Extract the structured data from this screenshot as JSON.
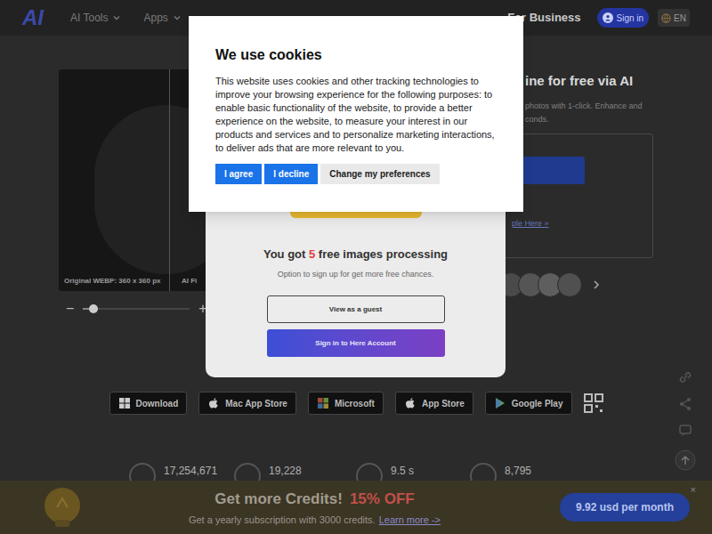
{
  "header": {
    "logo": "AI",
    "nav": [
      {
        "label": "AI Tools"
      },
      {
        "label": "Apps"
      }
    ],
    "business": "For Business",
    "sign_in": "Sign in",
    "language": "EN"
  },
  "hero": {
    "title": "ine for free via AI",
    "subtitle": [
      "photos with 1-click. Enhance and",
      "conds."
    ],
    "sample_link": "ple Here »"
  },
  "preview": {
    "caption_original": "Original WEBP: 360 x 360 px",
    "caption_result": "AI Fi",
    "zoom_out": "−",
    "zoom_in": "+",
    "zoom_level": 0.1
  },
  "stores": [
    {
      "label": "Download",
      "kind": "windows"
    },
    {
      "label": "Mac App Store",
      "kind": "apple"
    },
    {
      "label": "Microsoft",
      "kind": "microsoft"
    },
    {
      "label": "App Store",
      "kind": "apple"
    },
    {
      "label": "Google Play",
      "kind": "play"
    }
  ],
  "stats": [
    {
      "value": "17,254,671"
    },
    {
      "value": "19,228"
    },
    {
      "value": "9.5 s"
    },
    {
      "value": "8,795"
    }
  ],
  "promo": {
    "title": "Get more Credits!",
    "discount": "15% OFF",
    "text": "Get a yearly subscription with 3000 credits.",
    "link": "Learn more ->",
    "price_button": "9.92 usd per month",
    "close": "×"
  },
  "signup_modal": {
    "title_before": "You got ",
    "count": "5",
    "title_after": " free images processing",
    "subtitle": "Option to sign up for get more free chances.",
    "guest_button": "View as a guest",
    "sign_in_button": "Sign in to Here Account"
  },
  "cookie_dialog": {
    "title": "We use cookies",
    "body": "This website uses cookies and other tracking technologies to improve your browsing experience for the following purposes: to enable basic functionality of the website, to provide a better experience on the website, to measure your interest in our products and services and to personalize marketing interactions, to deliver ads that are more relevant to you.",
    "buttons": [
      {
        "label": "I agree",
        "primary": true
      },
      {
        "label": "I decline",
        "primary": true
      },
      {
        "label": "Change my preferences",
        "primary": false
      }
    ]
  }
}
